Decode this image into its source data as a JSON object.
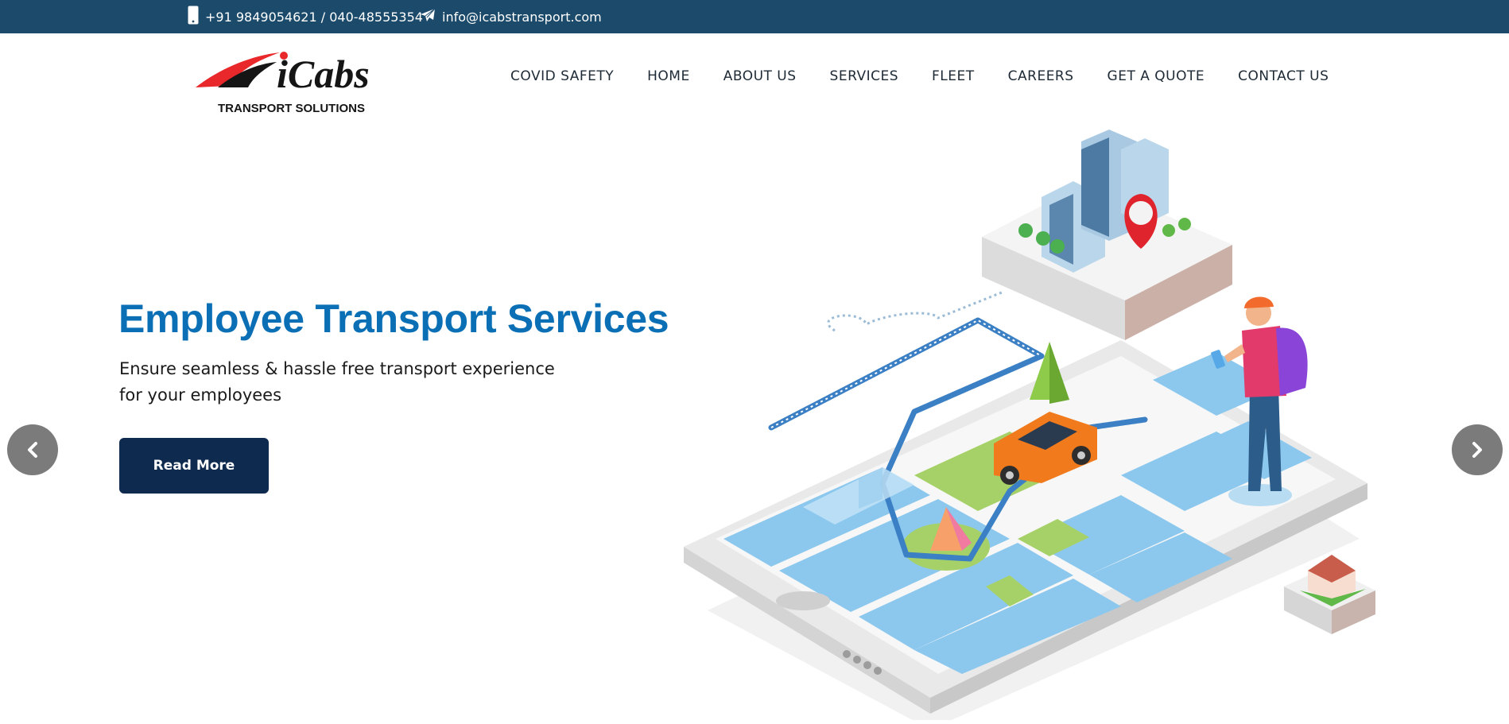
{
  "topbar": {
    "phone": "+91 9849054621 / 040-48555354",
    "email": "info@icabstransport.com",
    "phone_icon": "mobile-phone-icon",
    "email_icon": "paper-plane-icon"
  },
  "logo": {
    "brand": "iCabs",
    "tagline": "TRANSPORT SOLUTIONS"
  },
  "nav": {
    "items": [
      {
        "label": "COVID SAFETY"
      },
      {
        "label": "HOME"
      },
      {
        "label": "ABOUT US"
      },
      {
        "label": "SERVICES"
      },
      {
        "label": "FLEET"
      },
      {
        "label": "CAREERS"
      },
      {
        "label": "GET A QUOTE"
      },
      {
        "label": "CONTACT US"
      }
    ]
  },
  "hero": {
    "title": "Employee Transport Services",
    "subtitle_line1": "Ensure seamless & hassle free transport experience",
    "subtitle_line2": "for your employees",
    "button_label": "Read More"
  },
  "carousel": {
    "prev_icon": "chevron-left-icon",
    "next_icon": "chevron-right-icon"
  },
  "colors": {
    "topbar": "#1b4a6b",
    "title": "#0a6fb5",
    "button": "#0e2a4f",
    "arrow": "#7b7b7b"
  }
}
